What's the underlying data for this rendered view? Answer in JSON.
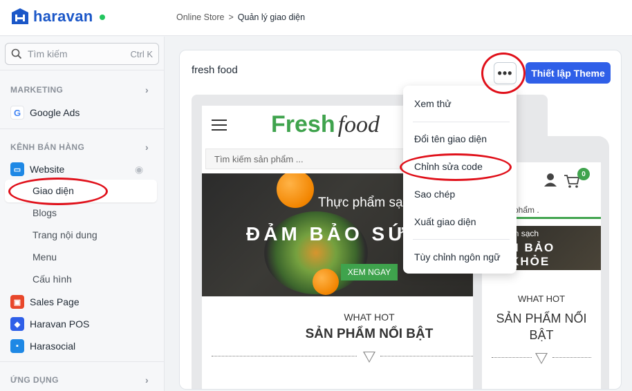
{
  "topbar": {
    "logo_text": "haravan",
    "breadcrumb": {
      "parent": "Online Store",
      "separator": ">",
      "current": "Quản lý giao diện"
    }
  },
  "sidebar": {
    "search": {
      "placeholder": "Tìm kiếm",
      "shortcut": "Ctrl K"
    },
    "sections": {
      "marketing": "MARKETING",
      "sales_channels": "KÊNH BÁN HÀNG",
      "apps": "ỨNG DỤNG"
    },
    "items": {
      "google_ads": "Google Ads",
      "website": "Website",
      "sales_page": "Sales Page",
      "haravan_pos": "Haravan POS",
      "harasocial": "Harasocial"
    },
    "website_sub": {
      "theme": "Giao diện",
      "blogs": "Blogs",
      "pages": "Trang nội dung",
      "menu": "Menu",
      "config": "Cấu hình"
    },
    "active_item": "Giao diện"
  },
  "main": {
    "theme_name": "fresh food",
    "more_label": "•••",
    "setup_button": "Thiết lập Theme"
  },
  "dropdown": {
    "items": [
      "Xem thử",
      "Đổi tên giao diện",
      "Chỉnh sửa code",
      "Sao chép",
      "Xuất giao diện",
      "Tùy chỉnh ngôn ngữ"
    ],
    "highlighted": "Chỉnh sửa code"
  },
  "preview": {
    "brand_fresh": "Fresh",
    "brand_food": "food",
    "search_placeholder": "Tìm kiếm sản phẩm ...",
    "hero_line1": "Thực phẩm sạch",
    "hero_line2": "ĐẢM BẢO SỨC KHỎE",
    "hero_button": "XEM NGAY",
    "what_hot": "WHAT HOT",
    "featured_title": "SẢN PHẨM NỔI BẬT",
    "cart_count": "0",
    "mobile": {
      "search_text": "m sản phẩm .",
      "hero_line1": "ực phẩm sạch",
      "hero_line2": "ĐẢM BẢO",
      "hero_line3": "ỨC KHỎE",
      "what_hot": "WHAT HOT",
      "featured_line1": "SẢN PHẨM NỔI",
      "featured_line2": "BẬT",
      "cart_count": "0"
    }
  },
  "colors": {
    "brand_blue": "#1b57c8",
    "primary_button": "#2f5fe8",
    "fresh_green": "#3fa34d",
    "annotation_red": "#e0101a"
  }
}
